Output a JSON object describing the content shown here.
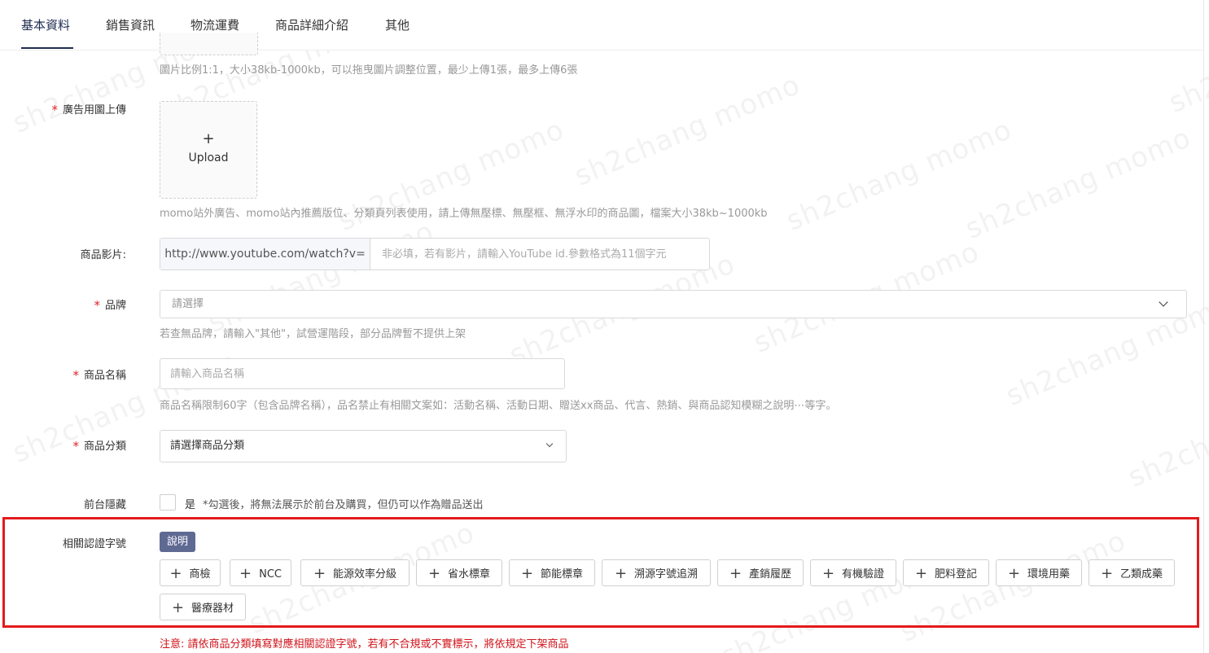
{
  "tabs": [
    {
      "label": "基本資料",
      "active": true
    },
    {
      "label": "銷售資訊",
      "active": false
    },
    {
      "label": "物流運費",
      "active": false
    },
    {
      "label": "商品詳細介紹",
      "active": false
    },
    {
      "label": "其他",
      "active": false
    }
  ],
  "product_images": {
    "hint": "圖片比例1:1，大小38kb-1000kb，可以拖曳圖片調整位置，最少上傳1張，最多上傳6張"
  },
  "ad_image": {
    "label": "廣告用圖上傳",
    "required_mark": "*",
    "upload_plus": "+",
    "upload_text": "Upload",
    "hint": "momo站外廣告、momo站內推薦版位、分類頁列表使用，請上傳無壓標、無壓框、無浮水印的商品圖，檔案大小38kb~1000kb"
  },
  "video": {
    "label": "商品影片:",
    "prefix": "http://www.youtube.com/watch?v=",
    "placeholder": "非必填，若有影片，請輸入YouTube id.參數格式為11個字元",
    "value": ""
  },
  "brand": {
    "label": "品牌",
    "required_mark": "*",
    "placeholder": "請選擇",
    "hint": "若查無品牌，請輸入\"其他\"，試營運階段，部分品牌暫不提供上架"
  },
  "product_name": {
    "label": "商品名稱",
    "required_mark": "*",
    "placeholder": "請輸入商品名稱",
    "value": "",
    "hint": "商品名稱限制60字（包含品牌名稱），品名禁止有相關文案如：活動名稱、活動日期、贈送xx商品、代言、熱銷、與商品認知模糊之說明⋯等字。"
  },
  "category": {
    "label": "商品分類",
    "required_mark": "*",
    "placeholder": "請選擇商品分類"
  },
  "frontend_hidden": {
    "label": "前台隱藏",
    "checked": false,
    "option_label": "是",
    "note": "*勾選後，將無法展示於前台及購買，但仍可以作為贈品送出"
  },
  "certification": {
    "label": "相關認證字號",
    "info_badge": "說明",
    "button_prefix": "+",
    "buttons": [
      "商檢",
      "NCC",
      "能源效率分級",
      "省水標章",
      "節能標章",
      "溯源字號追溯",
      "產銷履歷",
      "有機驗證",
      "肥料登記",
      "環境用藥",
      "乙類成藥",
      "醫療器材"
    ],
    "warning": "注意: 請依商品分類填寫對應相關認證字號，若有不合規或不實標示，將依規定下架商品"
  },
  "watermark": "sh2chang momo",
  "colors": {
    "primary": "#1f2d52",
    "required": "#e0242a",
    "badge": "#5f6a93",
    "highlight": "#e41a1c",
    "warning_text": "#d0131a"
  }
}
